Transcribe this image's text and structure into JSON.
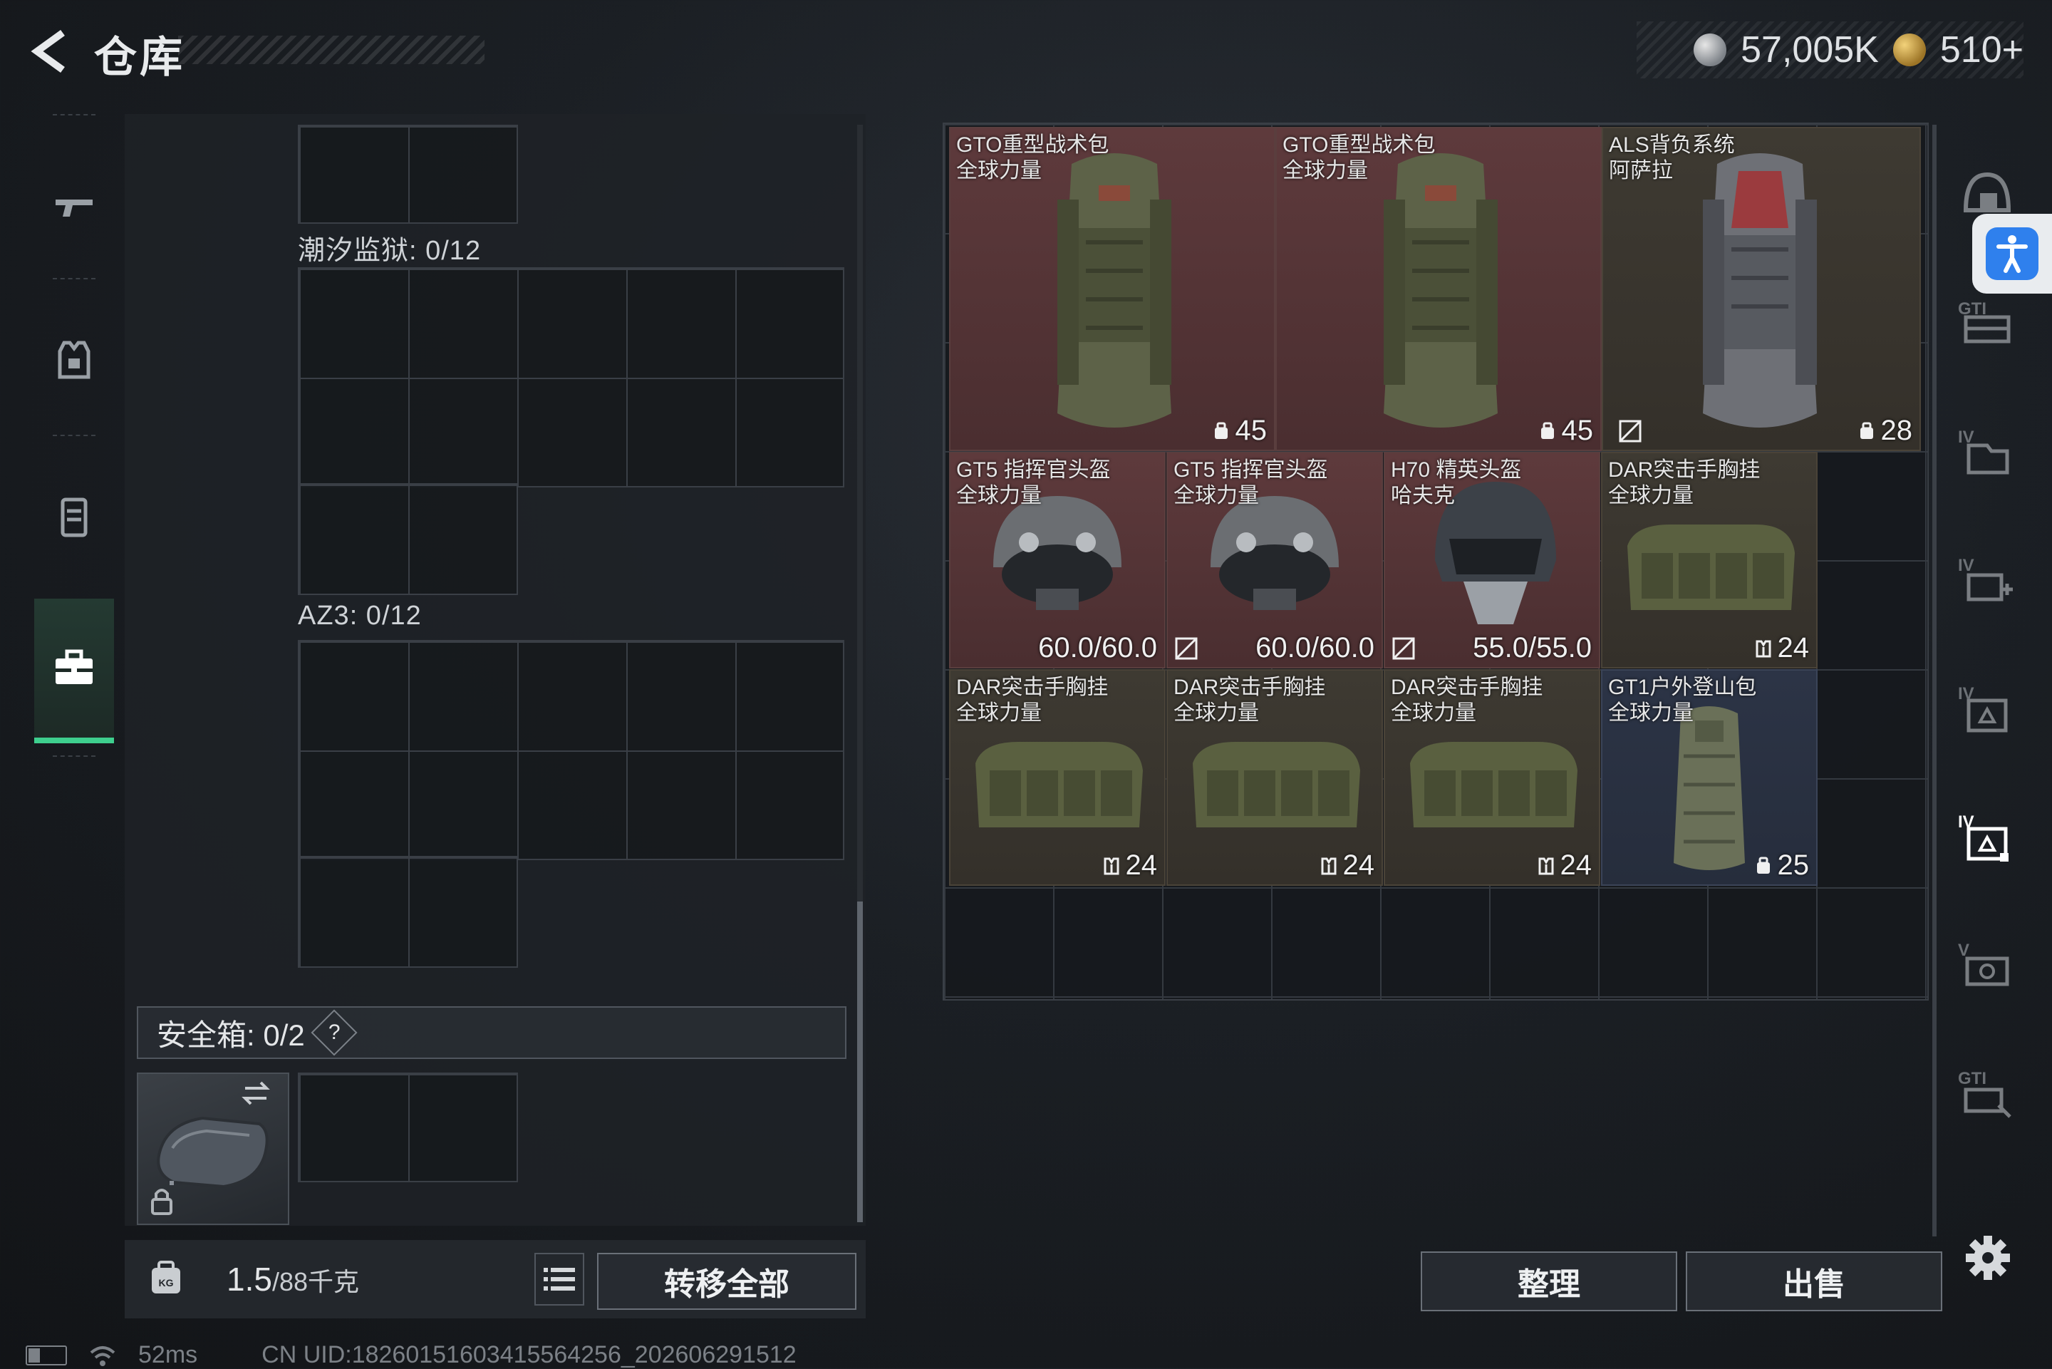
{
  "header": {
    "title": "仓库",
    "currencies": [
      {
        "icon": "silver-coin-icon",
        "value": "57,005K"
      },
      {
        "icon": "gold-coin-icon",
        "value": "510+"
      }
    ]
  },
  "left_nav": [
    {
      "name": "weapons",
      "icon": "gun-icon"
    },
    {
      "name": "armor",
      "icon": "vest-icon"
    },
    {
      "name": "magazines",
      "icon": "magazine-icon"
    },
    {
      "name": "containers",
      "icon": "toolbox-icon",
      "active": true
    }
  ],
  "containers": [
    {
      "label": "潮汐监狱: 0/12"
    },
    {
      "label": "AZ3: 0/12"
    }
  ],
  "safebox": {
    "label": "安全箱: 0/2",
    "help": "?"
  },
  "bottom_left": {
    "weight_current": "1.5",
    "weight_max": "/88千克",
    "transfer_all": "转移全部"
  },
  "stash_items": [
    {
      "name": "GTO重型战术包\n全球力量",
      "stat": "45",
      "stat_icon": "capacity-icon",
      "rarity": "red"
    },
    {
      "name": "GTO重型战术包\n全球力量",
      "stat": "45",
      "stat_icon": "capacity-icon",
      "rarity": "red"
    },
    {
      "name": "ALS背负系统\n阿萨拉",
      "stat": "28",
      "stat_icon": "capacity-icon",
      "rarity": "brown"
    },
    {
      "name": "GT5 指挥官头盔\n全球力量",
      "stat": "60.0/60.0",
      "stat_icon": "no-repair-icon",
      "rarity": "red"
    },
    {
      "name": "GT5 指挥官头盔\n全球力量",
      "stat": "60.0/60.0",
      "stat_icon": "no-repair-icon",
      "rarity": "red"
    },
    {
      "name": "H70 精英头盔\n哈夫克",
      "stat": "55.0/55.0",
      "stat_icon": "no-repair-icon",
      "rarity": "red"
    },
    {
      "name": "DAR突击手胸挂\n全球力量",
      "stat": "24",
      "stat_icon": "rig-icon",
      "rarity": "brown"
    },
    {
      "name": "DAR突击手胸挂\n全球力量",
      "stat": "24",
      "stat_icon": "rig-icon",
      "rarity": "brown"
    },
    {
      "name": "DAR突击手胸挂\n全球力量",
      "stat": "24",
      "stat_icon": "rig-icon",
      "rarity": "brown"
    },
    {
      "name": "DAR突击手胸挂\n全球力量",
      "stat": "24",
      "stat_icon": "rig-icon",
      "rarity": "brown"
    },
    {
      "name": "GT1户外登山包\n全球力量",
      "stat": "25",
      "stat_icon": "capacity-icon",
      "rarity": "blue"
    }
  ],
  "right_toolbar": [
    {
      "icon": "helmet-slot-icon",
      "label": ""
    },
    {
      "icon": "gti-slot-icon",
      "label": "GTI"
    },
    {
      "icon": "tier-4-slot-icon",
      "label": "IV"
    },
    {
      "icon": "tier-4-add-icon",
      "label": "IV"
    },
    {
      "icon": "tier-4-grid-icon",
      "label": "IV"
    },
    {
      "icon": "tier-4-grid-active-icon",
      "label": "IV",
      "active": true
    },
    {
      "icon": "tier-5-slot-icon",
      "label": "V"
    },
    {
      "icon": "gti-slot-2-icon",
      "label": "GTI"
    }
  ],
  "bottom_right": {
    "sort": "整理",
    "sell": "出售"
  },
  "status": {
    "ping": "52ms",
    "uid": "CN UID:18260151603415564256_202606291512"
  },
  "colors": {
    "accent_green": "#3ecf8e",
    "rarity_red": "#5e3a3c",
    "rarity_brown": "#3e3a32",
    "rarity_blue": "#2c3446",
    "accessibility_blue": "#2f80ed"
  }
}
